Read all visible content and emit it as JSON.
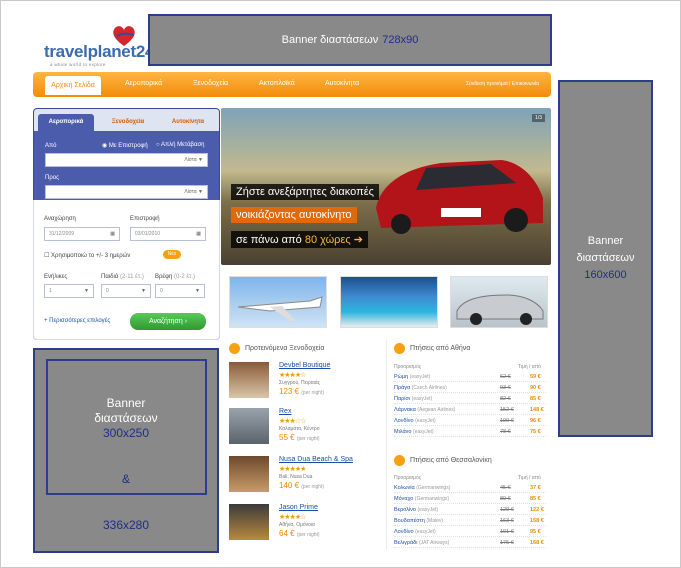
{
  "top_banner": {
    "label": "Banner διαστάσεων",
    "size": "728x90",
    "ghost_text": "Banner διαστάσεων 728x90"
  },
  "logo": {
    "name": "travelplanet",
    "num": "24",
    "suffix": ".com",
    "tagline": "a whole world to explore"
  },
  "nav": {
    "active": "Αρχική Σελίδα",
    "items": [
      "Αεροπορικά",
      "Ξενοδοχεία",
      "Ακτοπλοϊκά",
      "Αυτοκίνητα"
    ],
    "right": "Σύνδεση προνόμια  |  Επικοινωνία"
  },
  "search": {
    "tabs": [
      "Αεροπορικά",
      "Ξενοδοχεία",
      "Αυτοκίνητα"
    ],
    "from_label": "Από",
    "trip_return": "Με Επιστροφή",
    "trip_oneway": "Απλή Μετάβαση",
    "list_label": "Λίστα",
    "to_label": "Προς",
    "depart_label": "Αναχώρηση",
    "return_label": "Επιστροφή",
    "depart_value": "31/12/2009",
    "return_value": "03/01/2010",
    "flex_label": "Χρησιμοποιώ το +/- 3 ημερών",
    "adults_label": "Ενήλικες",
    "children_label": "Παιδιά",
    "children_hint": "(2-11 έτ.)",
    "infants_label": "Βρέφη",
    "infants_hint": "(0-2 έτ.)",
    "adults_value": "1",
    "children_value": "0",
    "infants_value": "0",
    "more_options": "+ Περισσότερες επιλογές",
    "submit": "Αναζήτηση"
  },
  "hero": {
    "line1": "Ζήστε ανεξάρτητες διακοπές",
    "line2": "νοικιάζοντας αυτοκίνητο",
    "line3_pre": "σε πάνω από",
    "line3_num": "80 χώρες",
    "pager": "1/3"
  },
  "side_banner": {
    "label1": "Banner",
    "label2": "διαστάσεων",
    "size": "160x600"
  },
  "left_banner": {
    "label1": "Banner",
    "label2": "διαστάσεων",
    "size1": "300x250",
    "amp": "&",
    "size2": "336x280"
  },
  "hotels": {
    "title": "Προτεινόμενα Ξενοδοχεία",
    "items": [
      {
        "name": "Devbel Boutique",
        "stars": "★★★★☆",
        "loc": "Συγγρού, Πειραιάς",
        "price": "123 €",
        "per": "(per night)"
      },
      {
        "name": "Rex",
        "stars": "★★★☆☆",
        "loc": "Καλαμάτα, Κέντρο",
        "price": "55 €",
        "per": "(per night)"
      },
      {
        "name": "Nusa Dua Beach & Spa",
        "stars": "★★★★★",
        "loc": "Bali, Nusa Dua",
        "price": "140 €",
        "per": "(per night)"
      },
      {
        "name": "Jason Prime",
        "stars": "★★★★☆",
        "loc": "Αθήνα, Ομόνοια",
        "price": "64 €",
        "per": "(per night)"
      }
    ]
  },
  "flights_athens": {
    "title": "Πτήσεις από Αθήνα",
    "col_dest": "Προορισμός",
    "col_price": "Τιμή / από",
    "rows": [
      {
        "dest": "Ρώμη",
        "air": "(easyJet)",
        "old": "62 €",
        "new": "59 €"
      },
      {
        "dest": "Πράγα",
        "air": "(Czech Airlines)",
        "old": "93 €",
        "new": "90 €"
      },
      {
        "dest": "Παρίσι",
        "air": "(easyJet)",
        "old": "82 €",
        "new": "85 €"
      },
      {
        "dest": "Λάρνακα",
        "air": "(Aegean Airlines)",
        "old": "152 €",
        "new": "148 €"
      },
      {
        "dest": "Λονδίνο",
        "air": "(easyJet)",
        "old": "100 €",
        "new": "96 €"
      },
      {
        "dest": "Μιλάνο",
        "air": "(easyJet)",
        "old": "78 €",
        "new": "75 €"
      }
    ]
  },
  "flights_thess": {
    "title": "Πτήσεις από Θεσσαλονίκη",
    "col_dest": "Προορισμός",
    "col_price": "Τιμή / από",
    "rows": [
      {
        "dest": "Κολωνία",
        "air": "(Germanwings)",
        "old": "45 €",
        "new": "37 €"
      },
      {
        "dest": "Μόναχο",
        "air": "(Germanwings)",
        "old": "89 €",
        "new": "85 €"
      },
      {
        "dest": "Βερολίνο",
        "air": "(easyJet)",
        "old": "129 €",
        "new": "122 €"
      },
      {
        "dest": "Βουδαπέστη",
        "air": "(Malev)",
        "old": "163 €",
        "new": "158 €"
      },
      {
        "dest": "Λονδίνο",
        "air": "(easyJet)",
        "old": "101 €",
        "new": "95 €"
      },
      {
        "dest": "Βελιγράδι",
        "air": "(JAT Airways)",
        "old": "175 €",
        "new": "168 €"
      }
    ]
  },
  "colors": {
    "accent": "#f28c0a",
    "banner_gray": "#898989",
    "banner_border": "#2c3d8e",
    "panel_blue": "#4c5cad"
  }
}
